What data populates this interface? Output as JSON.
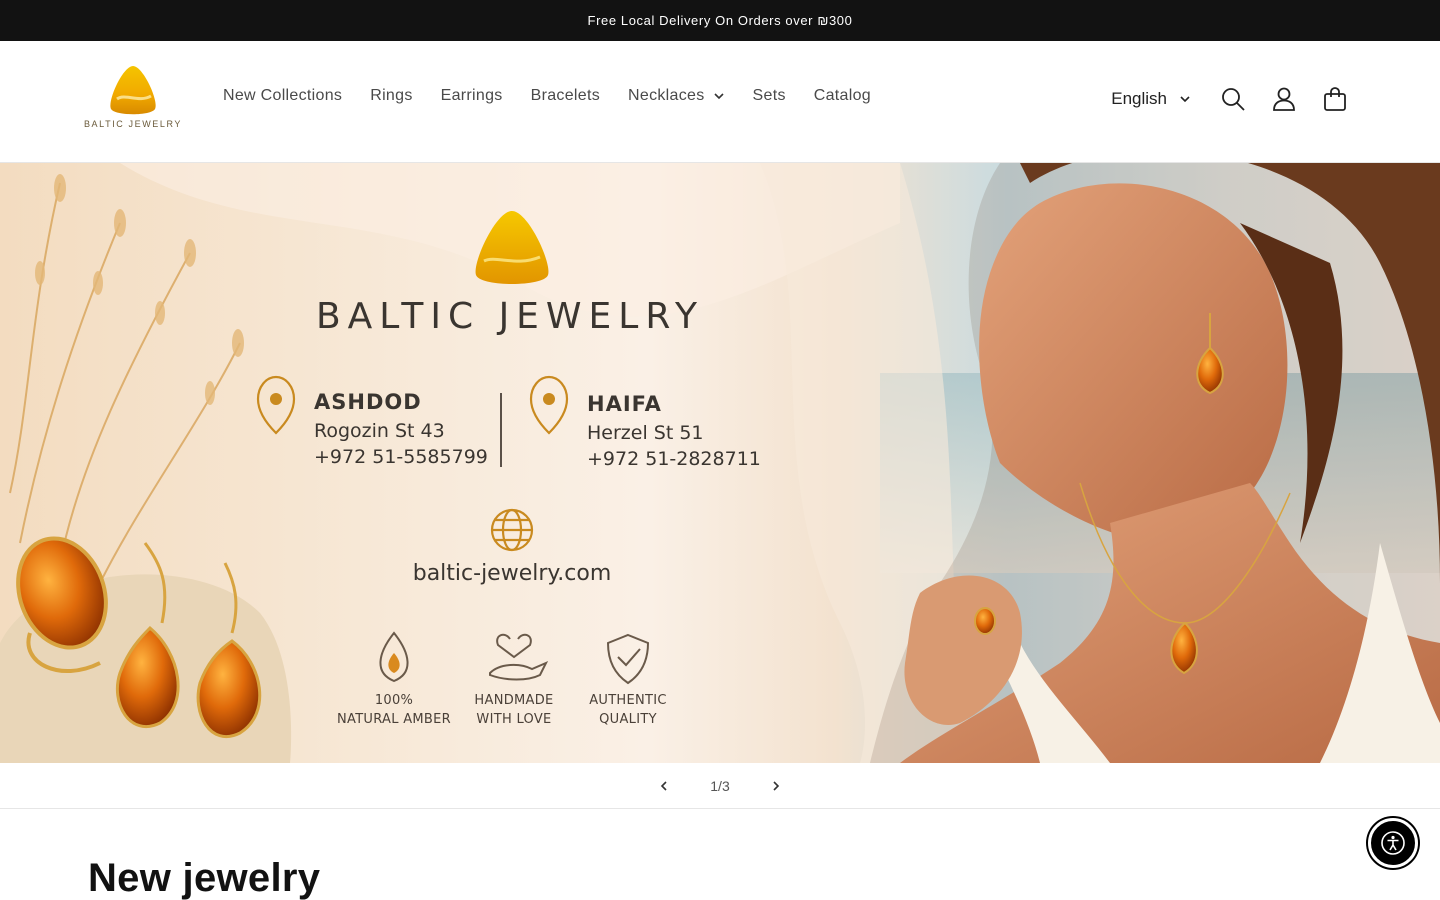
{
  "announcement": {
    "text": "Free Local Delivery On Orders over ₪300"
  },
  "header": {
    "logo_text": "BALTIC JEWELRY",
    "nav": [
      {
        "label": "New Collections",
        "has_dropdown": false
      },
      {
        "label": "Rings",
        "has_dropdown": false
      },
      {
        "label": "Earrings",
        "has_dropdown": false
      },
      {
        "label": "Bracelets",
        "has_dropdown": false
      },
      {
        "label": "Necklaces",
        "has_dropdown": true
      },
      {
        "label": "Sets",
        "has_dropdown": false
      },
      {
        "label": "Catalog",
        "has_dropdown": false
      }
    ],
    "language": "English",
    "icons": [
      "search-icon",
      "account-icon",
      "cart-icon",
      "chevron-down-icon"
    ]
  },
  "hero": {
    "brand": "BALTIC JEWELRY",
    "locations": [
      {
        "city": "ASHDOD",
        "street": "Rogozin St 43",
        "phone": "+972 51-5585799"
      },
      {
        "city": "HAIFA",
        "street": "Herzel St 51",
        "phone": "+972 51-2828711"
      }
    ],
    "website": "baltic-jewelry.com",
    "features": [
      {
        "line1": "100%",
        "line2": "NATURAL AMBER",
        "icon": "amber-drop-icon"
      },
      {
        "line1": "HANDMADE",
        "line2": "WITH LOVE",
        "icon": "heart-hand-icon"
      },
      {
        "line1": "AUTHENTIC",
        "line2": "QUALITY",
        "icon": "shield-check-icon"
      }
    ],
    "accent_color": "#c98a1f"
  },
  "slider": {
    "counter": "1/3"
  },
  "section": {
    "title": "New jewelry"
  },
  "colors": {
    "announcement_bg": "#121212",
    "accent": "#c98a1f",
    "text": "#121212"
  }
}
